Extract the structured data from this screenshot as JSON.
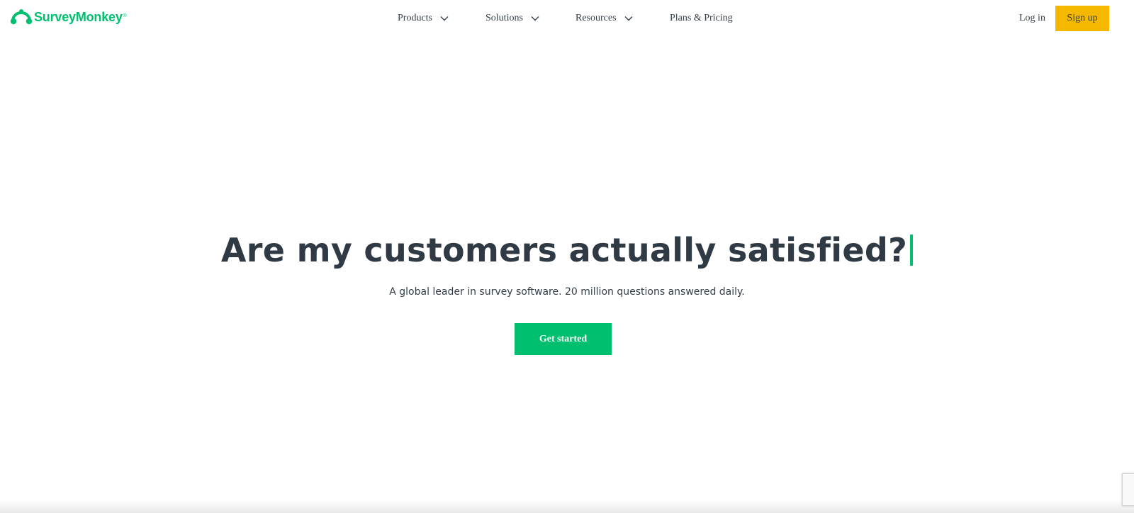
{
  "header": {
    "logo_text": "SurveyMonkey",
    "logo_reg": "®",
    "nav": {
      "products": "Products",
      "solutions": "Solutions",
      "resources": "Resources",
      "pricing": "Plans & Pricing"
    },
    "login_label": "Log in",
    "signup_label": "Sign up"
  },
  "hero": {
    "title": "Are my customers actually satisfied?",
    "subtitle": "A global leader in survey software. 20 million questions answered daily.",
    "cta_label": "Get started"
  },
  "colors": {
    "brand_green": "#00bf6f",
    "signup_yellow": "#f5b800",
    "text_dark": "#333e48"
  },
  "icons": {
    "logo": "surveymonkey-logo-icon",
    "dropdown": "chevron-down-icon"
  }
}
